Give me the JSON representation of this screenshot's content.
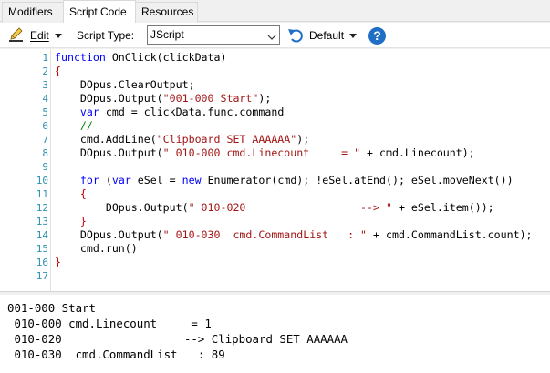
{
  "tabs": [
    {
      "label": "Modifiers",
      "active": false
    },
    {
      "label": "Script Code",
      "active": true
    },
    {
      "label": "Resources",
      "active": false
    }
  ],
  "toolbar": {
    "edit_label": "Edit",
    "script_type_label": "Script Type:",
    "script_type_value": "JScript",
    "default_label": "Default",
    "help_label": "?",
    "icons": [
      "edit-pencil-icon",
      "chevron-down-icon",
      "undo-default-icon",
      "help-icon"
    ]
  },
  "editor": {
    "line_numbers": [
      "1",
      "2",
      "3",
      "4",
      "5",
      "6",
      "7",
      "8",
      "9",
      "10",
      "11",
      "12",
      "13",
      "14",
      "15",
      "16",
      "17"
    ],
    "lines": [
      [
        {
          "t": "k",
          "v": "function"
        },
        {
          "t": "p",
          "v": " OnClick(clickData)"
        }
      ],
      [
        {
          "t": "brace",
          "v": "{"
        }
      ],
      [
        {
          "t": "p",
          "v": "    DOpus.ClearOutput;"
        }
      ],
      [
        {
          "t": "p",
          "v": "    DOpus.Output("
        },
        {
          "t": "s",
          "v": "\"001-000 Start\""
        },
        {
          "t": "p",
          "v": ");"
        }
      ],
      [
        {
          "t": "p",
          "v": "    "
        },
        {
          "t": "k",
          "v": "var"
        },
        {
          "t": "p",
          "v": " cmd = clickData.func.command"
        }
      ],
      [
        {
          "t": "c",
          "v": "    //"
        }
      ],
      [
        {
          "t": "p",
          "v": "    cmd.AddLine("
        },
        {
          "t": "s",
          "v": "\"Clipboard SET AAAAAA\""
        },
        {
          "t": "p",
          "v": ");"
        }
      ],
      [
        {
          "t": "p",
          "v": "    DOpus.Output("
        },
        {
          "t": "s",
          "v": "\" 010-000 cmd.Linecount     = \""
        },
        {
          "t": "p",
          "v": " + cmd.Linecount);"
        }
      ],
      [],
      [
        {
          "t": "p",
          "v": "    "
        },
        {
          "t": "k",
          "v": "for"
        },
        {
          "t": "p",
          "v": " ("
        },
        {
          "t": "k",
          "v": "var"
        },
        {
          "t": "p",
          "v": " eSel = "
        },
        {
          "t": "k",
          "v": "new"
        },
        {
          "t": "p",
          "v": " Enumerator(cmd); !eSel.atEnd(); eSel.moveNext())"
        }
      ],
      [
        {
          "t": "brace",
          "v": "    {"
        }
      ],
      [
        {
          "t": "p",
          "v": "        DOpus.Output("
        },
        {
          "t": "s",
          "v": "\" 010-020                  --> \""
        },
        {
          "t": "p",
          "v": " + eSel.item());"
        }
      ],
      [
        {
          "t": "brace",
          "v": "    }"
        }
      ],
      [
        {
          "t": "p",
          "v": "    DOpus.Output("
        },
        {
          "t": "s",
          "v": "\" 010-030  cmd.CommandList   : \""
        },
        {
          "t": "p",
          "v": " + cmd.CommandList.count);"
        }
      ],
      [
        {
          "t": "p",
          "v": "    cmd.run()"
        }
      ],
      [
        {
          "t": "brace",
          "v": "}"
        }
      ],
      []
    ]
  },
  "output": {
    "lines": [
      "001-000 Start",
      " 010-000 cmd.Linecount     = 1",
      " 010-020                  --> Clipboard SET AAAAAA",
      " 010-030  cmd.CommandList   : 89"
    ]
  },
  "colors": {
    "keyword": "#0000ff",
    "string": "#a31515",
    "comment": "#008000",
    "brace": "#c00000",
    "line_number": "#2b91af",
    "help_icon": "#1f6fc5"
  }
}
